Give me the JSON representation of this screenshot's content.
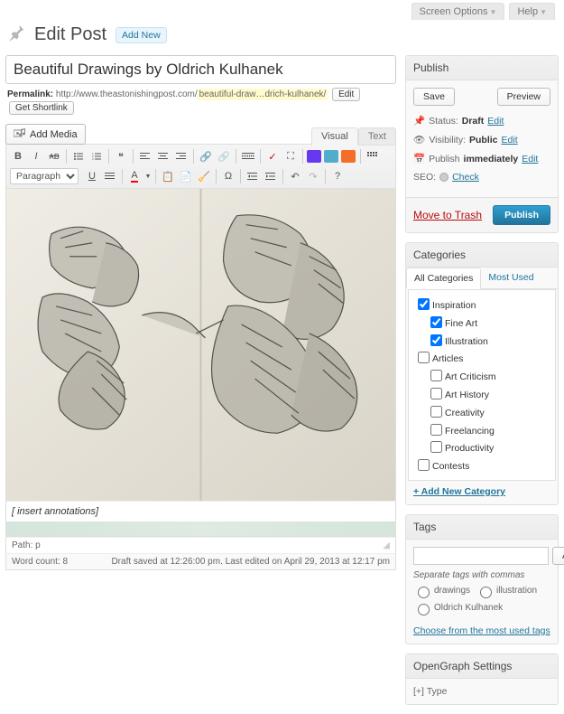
{
  "top_tabs": {
    "screen_options": "Screen Options",
    "help": "Help"
  },
  "header": {
    "title": "Edit Post",
    "add_new": "Add New"
  },
  "post": {
    "title": "Beautiful Drawings by Oldrich Kulhanek",
    "permalink_label": "Permalink:",
    "permalink_base": "http://www.theastonishingpost.com/",
    "permalink_slug": "beautiful-draw…drich-kulhanek/",
    "edit_btn": "Edit",
    "shortlink_btn": "Get Shortlink"
  },
  "media": {
    "add_media": "Add Media"
  },
  "editor_tabs": {
    "visual": "Visual",
    "text": "Text"
  },
  "format_select": "Paragraph",
  "annotations": "[ insert annotations]",
  "status": {
    "path_label": "Path:",
    "path_value": "p",
    "wordcount_label": "Word count:",
    "wordcount_value": "8",
    "saved": "Draft saved at 12:26:00 pm. Last edited on April 29, 2013 at 12:17 pm"
  },
  "publish": {
    "title": "Publish",
    "save": "Save",
    "preview": "Preview",
    "status_label": "Status:",
    "status_value": "Draft",
    "visibility_label": "Visibility:",
    "visibility_value": "Public",
    "schedule_label": "Publish",
    "schedule_value": "immediately",
    "seo_label": "SEO:",
    "seo_value": "Check",
    "edit": "Edit",
    "trash": "Move to Trash",
    "publish_btn": "Publish"
  },
  "categories": {
    "title": "Categories",
    "tab_all": "All Categories",
    "tab_most": "Most Used",
    "items": [
      {
        "label": "Inspiration",
        "checked": true,
        "indent": 0
      },
      {
        "label": "Fine Art",
        "checked": true,
        "indent": 1
      },
      {
        "label": "Illustration",
        "checked": true,
        "indent": 1
      },
      {
        "label": "Articles",
        "checked": false,
        "indent": 0
      },
      {
        "label": "Art Criticism",
        "checked": false,
        "indent": 1
      },
      {
        "label": "Art History",
        "checked": false,
        "indent": 1
      },
      {
        "label": "Creativity",
        "checked": false,
        "indent": 1
      },
      {
        "label": "Freelancing",
        "checked": false,
        "indent": 1
      },
      {
        "label": "Productivity",
        "checked": false,
        "indent": 1
      },
      {
        "label": "Contests",
        "checked": false,
        "indent": 0
      }
    ],
    "add_new": "+ Add New Category"
  },
  "tags": {
    "title": "Tags",
    "add": "Add",
    "separate": "Separate tags with commas",
    "suggestions": [
      "drawings",
      "illustration",
      "Oldrich Kulhanek"
    ],
    "choose": "Choose from the most used tags"
  },
  "opengraph": {
    "title": "OpenGraph Settings",
    "type": "[+] Type"
  }
}
